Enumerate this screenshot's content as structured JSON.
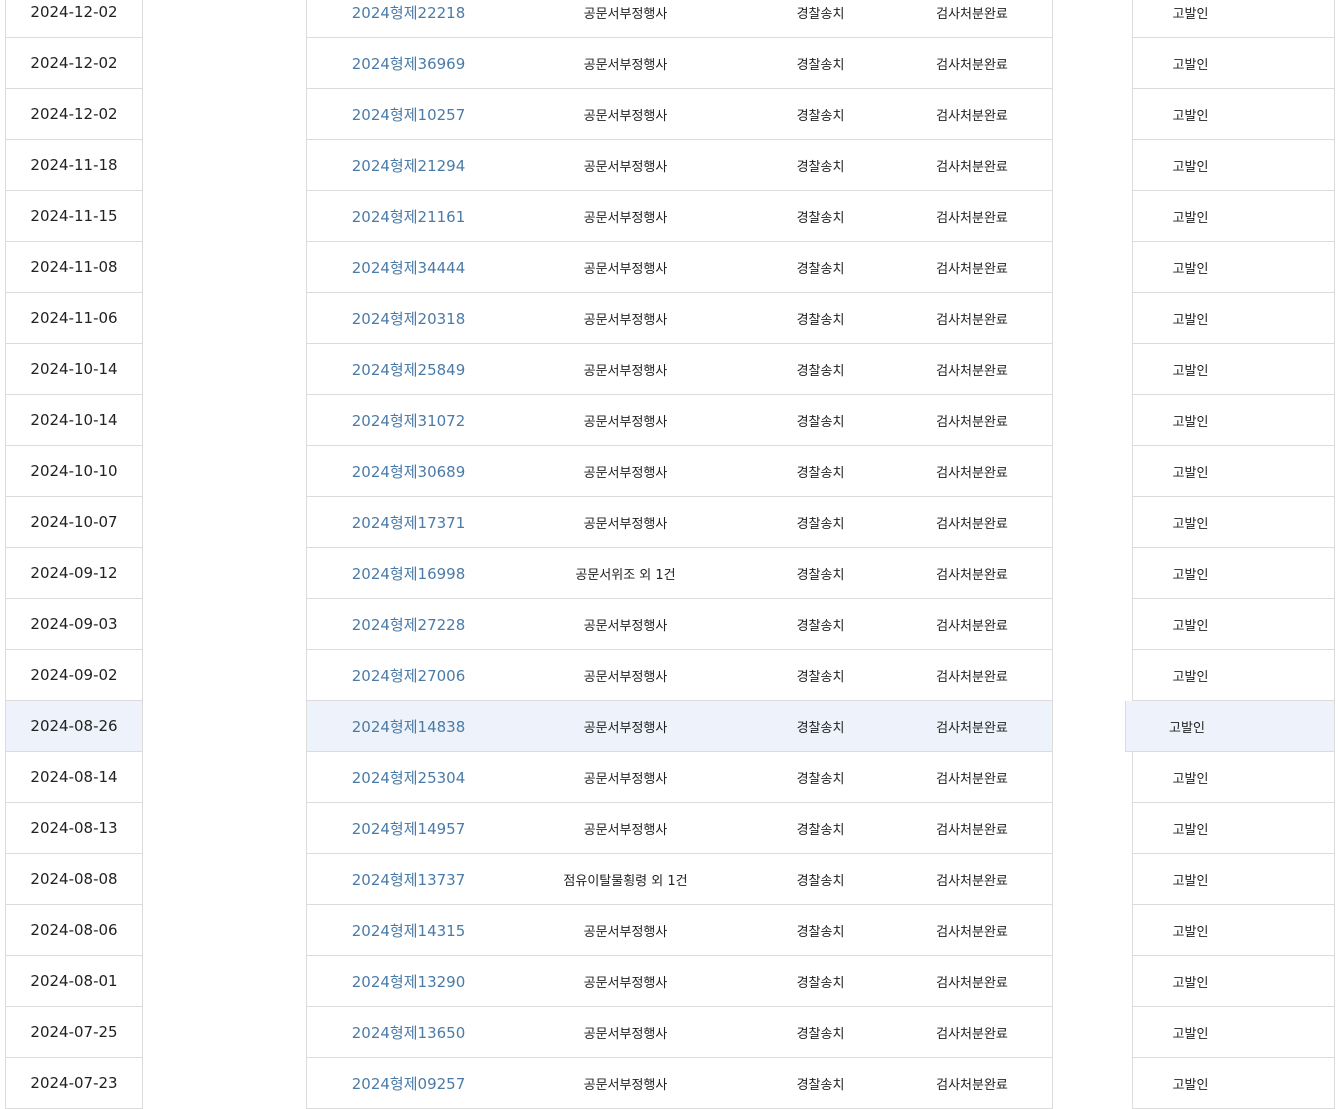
{
  "table": {
    "rows": [
      {
        "date": "2024-12-02",
        "case_no": "2024형제22218",
        "crime": "공문서부정행사",
        "police": "경찰송치",
        "result": "검사처분완료",
        "role": "고발인"
      },
      {
        "date": "2024-12-02",
        "case_no": "2024형제36969",
        "crime": "공문서부정행사",
        "police": "경찰송치",
        "result": "검사처분완료",
        "role": "고발인"
      },
      {
        "date": "2024-12-02",
        "case_no": "2024형제10257",
        "crime": "공문서부정행사",
        "police": "경찰송치",
        "result": "검사처분완료",
        "role": "고발인"
      },
      {
        "date": "2024-11-18",
        "case_no": "2024형제21294",
        "crime": "공문서부정행사",
        "police": "경찰송치",
        "result": "검사처분완료",
        "role": "고발인"
      },
      {
        "date": "2024-11-15",
        "case_no": "2024형제21161",
        "crime": "공문서부정행사",
        "police": "경찰송치",
        "result": "검사처분완료",
        "role": "고발인"
      },
      {
        "date": "2024-11-08",
        "case_no": "2024형제34444",
        "crime": "공문서부정행사",
        "police": "경찰송치",
        "result": "검사처분완료",
        "role": "고발인"
      },
      {
        "date": "2024-11-06",
        "case_no": "2024형제20318",
        "crime": "공문서부정행사",
        "police": "경찰송치",
        "result": "검사처분완료",
        "role": "고발인"
      },
      {
        "date": "2024-10-14",
        "case_no": "2024형제25849",
        "crime": "공문서부정행사",
        "police": "경찰송치",
        "result": "검사처분완료",
        "role": "고발인"
      },
      {
        "date": "2024-10-14",
        "case_no": "2024형제31072",
        "crime": "공문서부정행사",
        "police": "경찰송치",
        "result": "검사처분완료",
        "role": "고발인"
      },
      {
        "date": "2024-10-10",
        "case_no": "2024형제30689",
        "crime": "공문서부정행사",
        "police": "경찰송치",
        "result": "검사처분완료",
        "role": "고발인"
      },
      {
        "date": "2024-10-07",
        "case_no": "2024형제17371",
        "crime": "공문서부정행사",
        "police": "경찰송치",
        "result": "검사처분완료",
        "role": "고발인"
      },
      {
        "date": "2024-09-12",
        "case_no": "2024형제16998",
        "crime": "공문서위조 외 1건",
        "police": "경찰송치",
        "result": "검사처분완료",
        "role": "고발인"
      },
      {
        "date": "2024-09-03",
        "case_no": "2024형제27228",
        "crime": "공문서부정행사",
        "police": "경찰송치",
        "result": "검사처분완료",
        "role": "고발인"
      },
      {
        "date": "2024-09-02",
        "case_no": "2024형제27006",
        "crime": "공문서부정행사",
        "police": "경찰송치",
        "result": "검사처분완료",
        "role": "고발인"
      },
      {
        "date": "2024-08-26",
        "case_no": "2024형제14838",
        "crime": "공문서부정행사",
        "police": "경찰송치",
        "result": "검사처분완료",
        "role": "고발인",
        "highlighted": true
      },
      {
        "date": "2024-08-14",
        "case_no": "2024형제25304",
        "crime": "공문서부정행사",
        "police": "경찰송치",
        "result": "검사처분완료",
        "role": "고발인"
      },
      {
        "date": "2024-08-13",
        "case_no": "2024형제14957",
        "crime": "공문서부정행사",
        "police": "경찰송치",
        "result": "검사처분완료",
        "role": "고발인"
      },
      {
        "date": "2024-08-08",
        "case_no": "2024형제13737",
        "crime": "점유이탈물횡령 외 1건",
        "police": "경찰송치",
        "result": "검사처분완료",
        "role": "고발인"
      },
      {
        "date": "2024-08-06",
        "case_no": "2024형제14315",
        "crime": "공문서부정행사",
        "police": "경찰송치",
        "result": "검사처분완료",
        "role": "고발인"
      },
      {
        "date": "2024-08-01",
        "case_no": "2024형제13290",
        "crime": "공문서부정행사",
        "police": "경찰송치",
        "result": "검사처분완료",
        "role": "고발인"
      },
      {
        "date": "2024-07-25",
        "case_no": "2024형제13650",
        "crime": "공문서부정행사",
        "police": "경찰송치",
        "result": "검사처분완료",
        "role": "고발인"
      },
      {
        "date": "2024-07-23",
        "case_no": "2024형제09257",
        "crime": "공문서부정행사",
        "police": "경찰송치",
        "result": "검사처분완료",
        "role": "고발인"
      }
    ]
  }
}
